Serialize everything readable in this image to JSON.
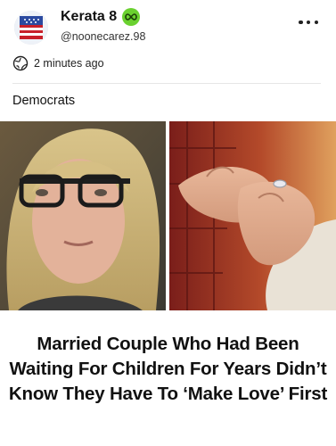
{
  "post": {
    "author_name": "Kerata 8",
    "author_handle": "@noonecarez.98",
    "timestamp": "2 minutes ago",
    "topic": "Democrats",
    "headline": "Married Couple Who Had Been Waiting For Children For Years Didn’t Know They Have To ‘Make Love’ First"
  },
  "icons": {
    "badge": "infinity-badge-icon",
    "time": "globe-clock-icon",
    "menu": "more-options-icon"
  },
  "colors": {
    "badge": "#6ad12f",
    "text": "#111111"
  }
}
